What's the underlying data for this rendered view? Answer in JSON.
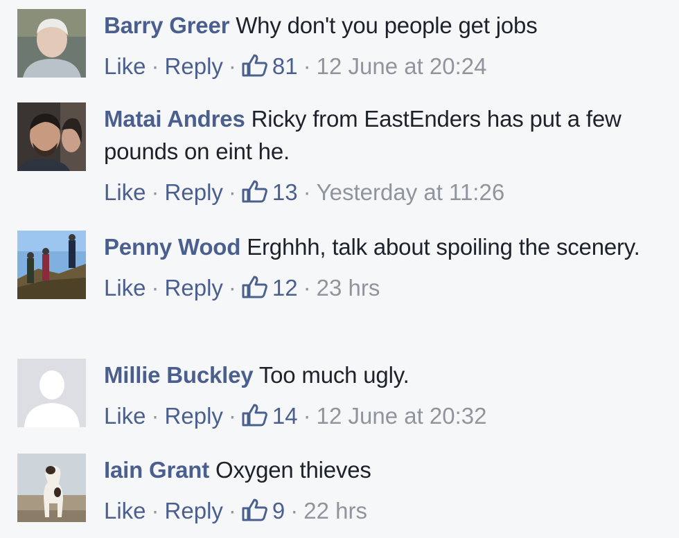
{
  "comments": [
    {
      "author": "Barry Greer",
      "text": "Why don't you people get jobs",
      "like_label": "Like",
      "reply_label": "Reply",
      "likes": "81",
      "time": "12 June at 20:24",
      "avatar": "photo-elderly-man"
    },
    {
      "author": "Matai Andres",
      "text": "Ricky from EastEnders has put a few pounds on eint he.",
      "like_label": "Like",
      "reply_label": "Reply",
      "likes": "13",
      "time": "Yesterday at 11:26",
      "avatar": "photo-man-selfie"
    },
    {
      "author": "Penny Wood",
      "text": "Erghhh, talk about spoiling the scenery.",
      "like_label": "Like",
      "reply_label": "Reply",
      "likes": "12",
      "time": "23 hrs",
      "avatar": "photo-hikers"
    },
    {
      "author": "Millie Buckley",
      "text": "Too much ugly.",
      "like_label": "Like",
      "reply_label": "Reply",
      "likes": "14",
      "time": "12 June at 20:32",
      "avatar": "default-silhouette"
    },
    {
      "author": "Iain Grant",
      "text": "Oxygen thieves",
      "like_label": "Like",
      "reply_label": "Reply",
      "likes": "9",
      "time": "22 hrs",
      "avatar": "photo-dog"
    }
  ],
  "colors": {
    "background": "#f6f7f9",
    "link": "#4b5f8f",
    "text": "#1d2129",
    "muted": "#90949c"
  }
}
